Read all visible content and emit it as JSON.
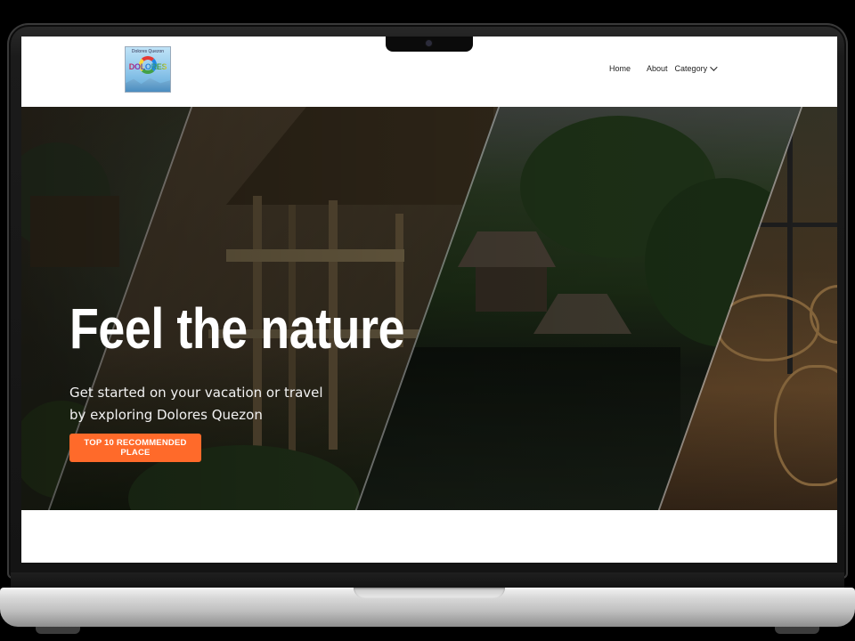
{
  "header": {
    "logo_alt": "Dolores Quezon logo",
    "logo_text": "DOLORES",
    "logo_top_text": "Dolores Quezon"
  },
  "nav": {
    "items": [
      {
        "label": "Home"
      },
      {
        "label": "About"
      },
      {
        "label": "Category",
        "icon": "chevron-down-icon"
      }
    ]
  },
  "hero": {
    "title": "Feel the nature",
    "subtitle": "Get started on your vacation or travel by exploring Dolores Quezon",
    "button_label": "TOP 10 RECOMMENDED PLACE"
  },
  "colors": {
    "accent": "#ff6a2a",
    "header_bg": "#ffffff",
    "hero_text": "#ffffff"
  }
}
